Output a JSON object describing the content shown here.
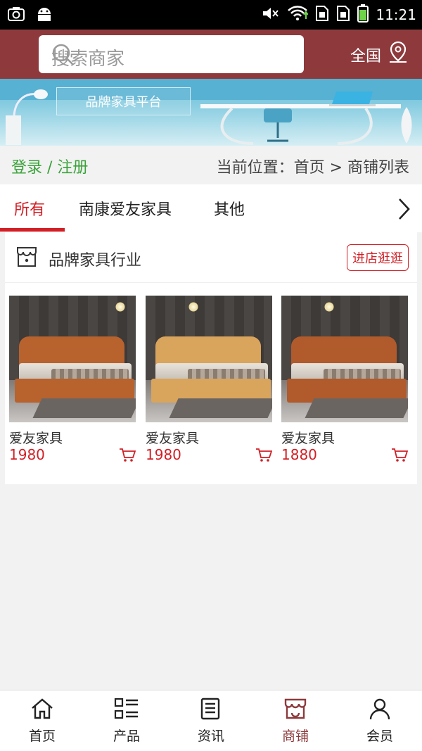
{
  "status_bar": {
    "time": "11:21"
  },
  "header": {
    "search_placeholder": "搜索商家",
    "region_label": "全国"
  },
  "banner": {
    "label": "品牌家具平台"
  },
  "crumbbar": {
    "login_register": "登录 / 注册",
    "location": "当前位置：首页 > 商铺列表"
  },
  "tabs": [
    {
      "label": "所有",
      "active": true
    },
    {
      "label": "南康爱友家具",
      "active": false
    },
    {
      "label": "其他",
      "active": false
    }
  ],
  "store": {
    "name": "品牌家具行业",
    "visit_label": "进店逛逛",
    "products": [
      {
        "title": "爱友家具",
        "price": "1980",
        "wood": "#b8622e"
      },
      {
        "title": "爱友家具",
        "price": "1980",
        "wood": "#d9a45c"
      },
      {
        "title": "爱友家具",
        "price": "1880",
        "wood": "#b15a2c"
      }
    ]
  },
  "bottom_nav": [
    {
      "label": "首页",
      "icon": "home-icon",
      "active": false
    },
    {
      "label": "产品",
      "icon": "grid-list-icon",
      "active": false
    },
    {
      "label": "资讯",
      "icon": "news-icon",
      "active": false
    },
    {
      "label": "商铺",
      "icon": "store-icon",
      "active": true
    },
    {
      "label": "会员",
      "icon": "user-icon",
      "active": false
    }
  ],
  "colors": {
    "header": "#8e3a3d",
    "accent_red": "#d11f25",
    "login_green": "#3aa33a"
  }
}
